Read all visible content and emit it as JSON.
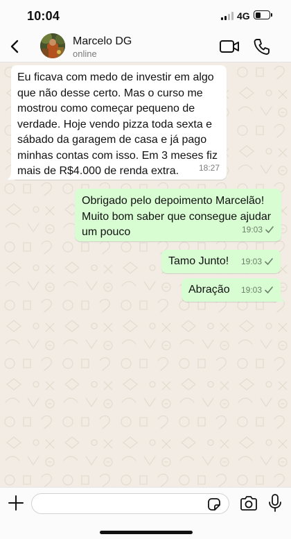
{
  "status_bar": {
    "time": "10:04",
    "network": "4G",
    "signal_bars": 2,
    "battery_level": 0.4
  },
  "header": {
    "contact_name": "Marcelo DG",
    "contact_status": "online",
    "icons": {
      "back": "chevron-left-icon",
      "video": "video-camera-icon",
      "call": "phone-icon"
    }
  },
  "messages": [
    {
      "direction": "incoming",
      "lines": [
        "Eu ficava com medo de investir em algo",
        "que não desse certo. Mas o curso me",
        "mostrou como começar pequeno de",
        "verdade. Hoje vendo pizza toda sexta e",
        "sábado da garagem de casa e já pago",
        "minhas contas com isso. Em 3 meses fiz",
        "mais de R$4.000 de renda extra."
      ],
      "time": "18:27"
    },
    {
      "direction": "outgoing",
      "lines": [
        "Obrigado pelo depoimento Marcelão!",
        "Muito bom saber que consegue ajudar",
        "um pouco"
      ],
      "time": "19:03",
      "status": "sent"
    },
    {
      "direction": "outgoing",
      "lines": [
        "Tamo Junto!"
      ],
      "time": "19:03",
      "status": "sent"
    },
    {
      "direction": "outgoing",
      "lines": [
        "Abração"
      ],
      "time": "19:03",
      "status": "sent"
    }
  ],
  "input": {
    "value": "",
    "placeholder": "",
    "icons": {
      "attach": "plus-icon",
      "sticker": "sticker-icon",
      "camera": "camera-icon",
      "mic": "microphone-icon"
    }
  },
  "colors": {
    "chat_background": "#f2ece4",
    "incoming_bubble": "#ffffff",
    "outgoing_bubble": "#d9fdd3",
    "bar_background": "#fbfbfb"
  }
}
